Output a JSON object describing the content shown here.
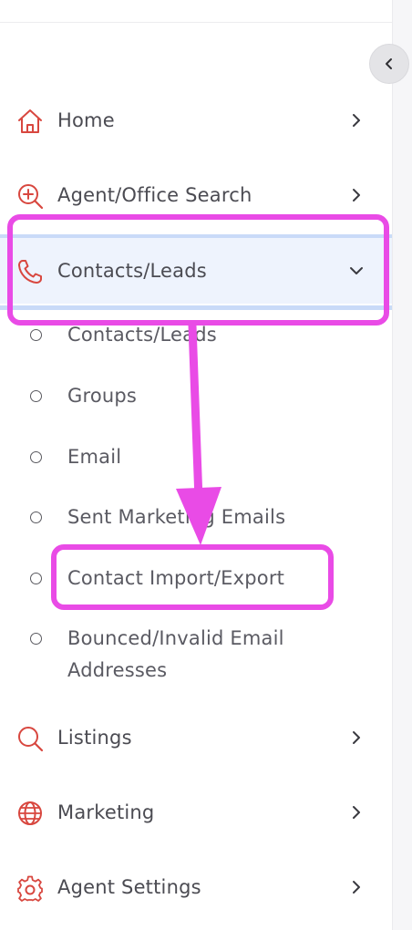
{
  "colors": {
    "accent_icon": "#d8473f",
    "highlight": "#e94be6",
    "active_bg": "#eef3fd",
    "active_line": "#c9daf8",
    "text": "#4b4b52"
  },
  "collapse_button": {
    "icon": "chevron-left-icon"
  },
  "nav": {
    "items": [
      {
        "label": "Home",
        "icon": "home-icon",
        "chevron": "chevron-right-icon"
      },
      {
        "label": "Agent/Office Search",
        "icon": "search-plus-icon",
        "chevron": "chevron-right-icon"
      },
      {
        "label": "Contacts/Leads",
        "icon": "phone-icon",
        "chevron": "chevron-down-icon",
        "expanded": true
      },
      {
        "label": "Listings",
        "icon": "search-icon",
        "chevron": "chevron-right-icon"
      },
      {
        "label": "Marketing",
        "icon": "globe-icon",
        "chevron": "chevron-right-icon"
      },
      {
        "label": "Agent Settings",
        "icon": "gear-icon",
        "chevron": "chevron-right-icon"
      }
    ],
    "subitems": [
      {
        "label": "Contacts/Leads"
      },
      {
        "label": "Groups"
      },
      {
        "label": "Email"
      },
      {
        "label": "Sent Marketing Emails"
      },
      {
        "label": "Contact Import/Export"
      },
      {
        "label_line1": "Bounced/Invalid Email",
        "label_line2": "Addresses"
      }
    ]
  }
}
